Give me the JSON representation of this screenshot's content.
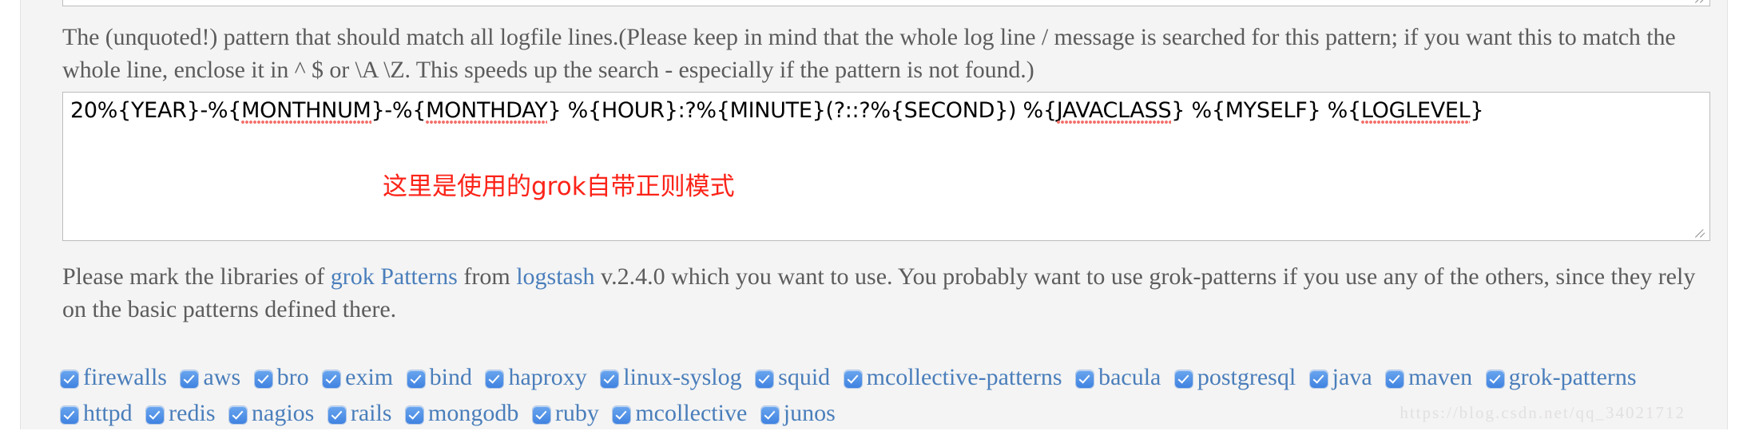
{
  "help": {
    "paragraph": "The (unquoted!) pattern that should match all logfile lines.(Please keep in mind that the whole log line / message is searched for this pattern; if you want this to match the whole line, enclose it in ^ $ or \\A \\Z. This speeds up the search - especially if the pattern is not found.)"
  },
  "pattern_field": {
    "value": "20%{YEAR}-%{MONTHNUM}-%{MONTHDAY} %{HOUR}:?%{MINUTE}(?::?%{SECOND}) %{JAVACLASS} %{MYSELF} %{LOGLEVEL}",
    "segments": [
      {
        "text": "20%{YEAR}-%{",
        "misspelled": false
      },
      {
        "text": "MONTHNUM",
        "misspelled": true
      },
      {
        "text": "}-%{",
        "misspelled": false
      },
      {
        "text": "MONTHDAY",
        "misspelled": true
      },
      {
        "text": "} %{HOUR}:?%{MINUTE}(?::?%{SECOND}) %{",
        "misspelled": false
      },
      {
        "text": "JAVACLASS",
        "misspelled": true
      },
      {
        "text": "} %{MYSELF} %{",
        "misspelled": false
      },
      {
        "text": "LOGLEVEL",
        "misspelled": true
      },
      {
        "text": "}",
        "misspelled": false
      }
    ],
    "annotation": "这里是使用的grok自带正则模式",
    "annotation_color": "#fb2318",
    "resize_handle": "resize-grip-icon"
  },
  "libraries_note": {
    "before_link1": "Please mark the libraries of ",
    "link1": "grok Patterns",
    "between_links": " from ",
    "link2": "logstash",
    "after_link2": " v.2.4.0 which you want to use. You probably want to use grok-patterns if you use any of the others, since they rely on the basic patterns defined there.",
    "link_color": "#4a7ebb"
  },
  "library_checkboxes": [
    {
      "label": "firewalls",
      "checked": true
    },
    {
      "label": "aws",
      "checked": true
    },
    {
      "label": "bro",
      "checked": true
    },
    {
      "label": "exim",
      "checked": true
    },
    {
      "label": "bind",
      "checked": true
    },
    {
      "label": "haproxy",
      "checked": true
    },
    {
      "label": "linux-syslog",
      "checked": true
    },
    {
      "label": "squid",
      "checked": true
    },
    {
      "label": "mcollective-patterns",
      "checked": true
    },
    {
      "label": "bacula",
      "checked": true
    },
    {
      "label": "postgresql",
      "checked": true
    },
    {
      "label": "java",
      "checked": true
    },
    {
      "label": "maven",
      "checked": true
    },
    {
      "label": "grok-patterns",
      "checked": true
    },
    {
      "label": "httpd",
      "checked": true
    },
    {
      "label": "redis",
      "checked": true
    },
    {
      "label": "nagios",
      "checked": true
    },
    {
      "label": "rails",
      "checked": true
    },
    {
      "label": "mongodb",
      "checked": true
    },
    {
      "label": "ruby",
      "checked": true
    },
    {
      "label": "mcollective",
      "checked": true
    },
    {
      "label": "junos",
      "checked": true
    }
  ],
  "watermark": {
    "text": "https://blog.csdn.net/qq_34021712"
  }
}
